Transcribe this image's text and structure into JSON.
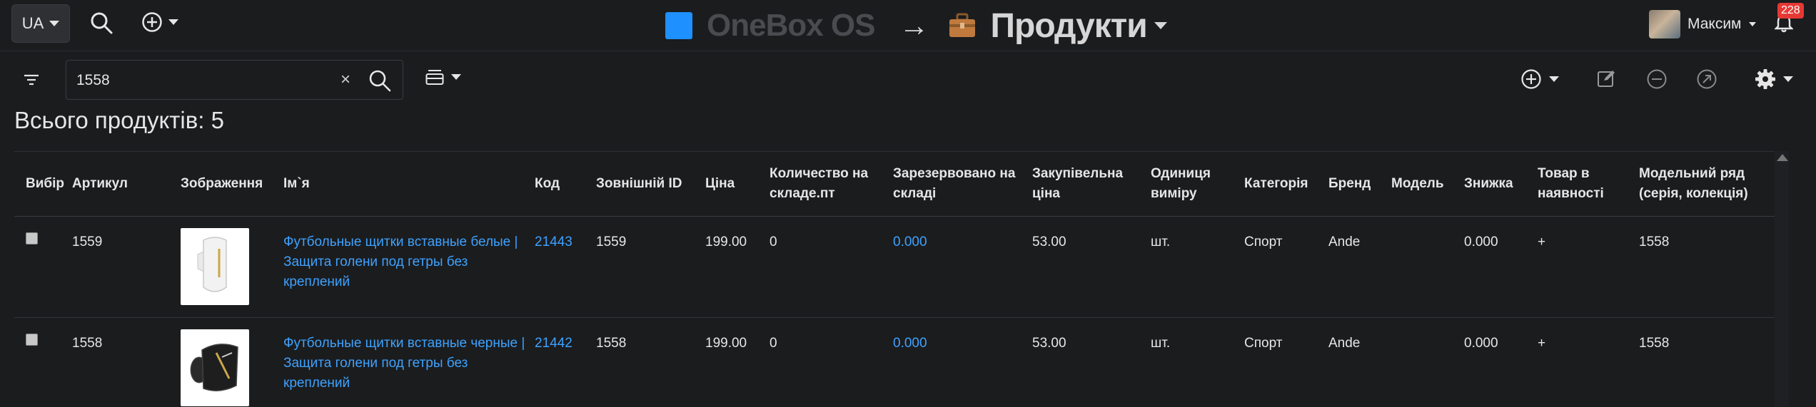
{
  "topbar": {
    "language": "UA",
    "brand_name": "OneBox OS",
    "section_title": "Продукти",
    "user_name": "Максим",
    "notifications_count": "228"
  },
  "toolbar": {
    "search_value": "1558",
    "clear_symbol": "×"
  },
  "summary": {
    "text": "Всього продуктів: 5"
  },
  "table": {
    "columns": [
      "Вибір",
      "Артикул",
      "Зображення",
      "Ім`я",
      "Код",
      "Зовнішній ID",
      "Ціна",
      "Количество на складе.пт",
      "Зарезервовано на складі",
      "Закупівельна ціна",
      "Одиниця виміру",
      "Категорія",
      "Бренд",
      "Модель",
      "Знижка",
      "Товар в наявності",
      "Модельний ряд (серія, колекція)"
    ],
    "rows": [
      {
        "article": "1559",
        "image_color": "white",
        "name": "Футбольные щитки вставные белые | Защита голени под гетры без креплений",
        "code": "21443",
        "external_id": "1559",
        "price": "199.00",
        "stock": "0",
        "reserved": "0.000",
        "purchase_price": "53.00",
        "unit": "шт.",
        "category": "Спорт",
        "brand": "Ande",
        "model": "",
        "discount": "0.000",
        "in_stock": "+",
        "series": "1558"
      },
      {
        "article": "1558",
        "image_color": "black",
        "name": "Футбольные щитки вставные черные | Защита голени под гетры без креплений",
        "code": "21442",
        "external_id": "1558",
        "price": "199.00",
        "stock": "0",
        "reserved": "0.000",
        "purchase_price": "53.00",
        "unit": "шт.",
        "category": "Спорт",
        "brand": "Ande",
        "model": "",
        "discount": "0.000",
        "in_stock": "+",
        "series": "1558"
      }
    ]
  },
  "colors": {
    "background": "#1b1c1e",
    "accent": "#1e90ff",
    "link": "#3ea2ff",
    "badge": "#e53935"
  }
}
